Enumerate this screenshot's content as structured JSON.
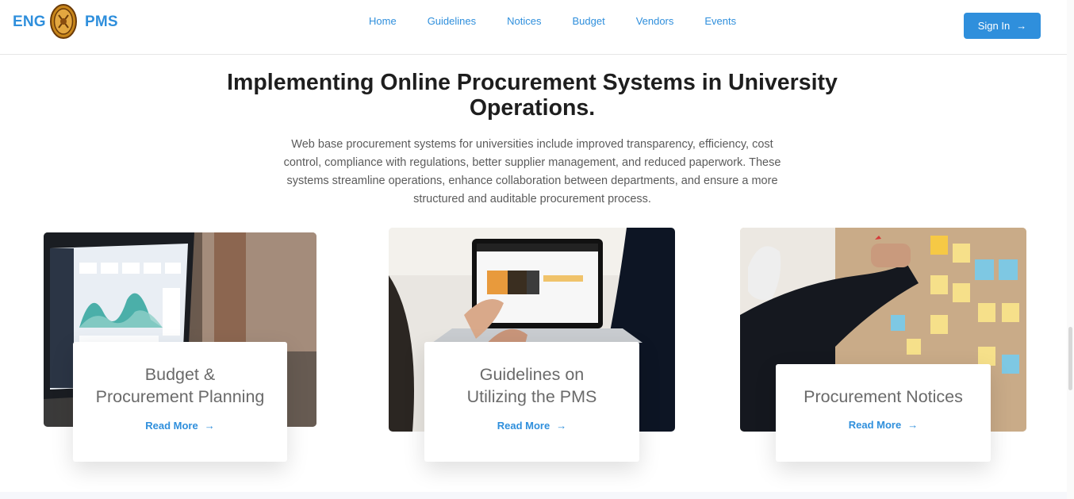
{
  "header": {
    "brand_left": "ENG",
    "brand_right": "PMS",
    "logo_icon": "university-seal-logo",
    "nav": [
      "Home",
      "Guidelines",
      "Notices",
      "Budget",
      "Vendors",
      "Events"
    ],
    "signin_label": "Sign In",
    "signin_icon": "arrow-right-icon"
  },
  "hero": {
    "title_line1": "Implementing Online Procurement Systems in University",
    "title_line2": "Operations.",
    "desc_line1": "Web base procurement systems for universities include improved transparency, efficiency, cost",
    "desc_line2": "control, compliance with regulations, better supplier management, and reduced paperwork. These",
    "desc_line3": "systems streamline operations, enhance collaboration between departments, and ensure a more",
    "desc_line4": "structured and auditable procurement process."
  },
  "cards": [
    {
      "title_line1": "Budget &",
      "title_line2": "Procurement Planning",
      "link": "Read More",
      "image_icon": "laptop-dashboard-image"
    },
    {
      "title_line1": "Guidelines on",
      "title_line2": "Utilizing the PMS",
      "link": "Read More",
      "image_icon": "laptop-presentation-image"
    },
    {
      "title_line1": "Procurement Notices",
      "link": "Read More",
      "image_icon": "sticky-notes-board-image"
    }
  ],
  "colors": {
    "accent": "#2f8fdc",
    "title": "#1e1e1e",
    "card_title": "#6a6a6a"
  }
}
